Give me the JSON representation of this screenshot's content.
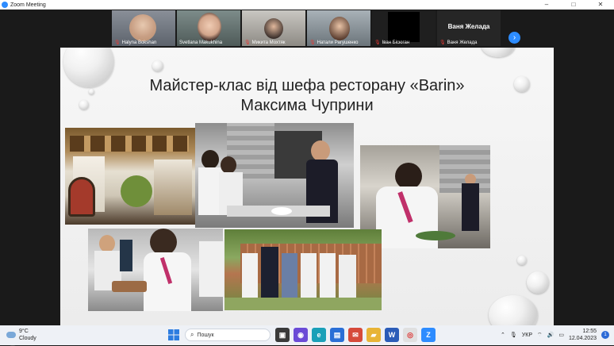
{
  "window": {
    "title": "Zoom Meeting",
    "controls": [
      "–",
      "□",
      "✕"
    ]
  },
  "participants": [
    {
      "name": "Halyna Bokshan",
      "muted": true
    },
    {
      "name": "Svetlana Makukhina",
      "muted": false
    },
    {
      "name": "Микита Мохтяк",
      "muted": true
    },
    {
      "name": "Натали Рагушенко",
      "muted": true
    },
    {
      "name": "Іван Бісюган",
      "muted": true
    },
    {
      "name": "Ваня Желада",
      "muted": true,
      "display_name": "Ваня Желада"
    }
  ],
  "next_page": "›",
  "slide": {
    "title_line1": "Майстер-клас від шефа ресторану «Barin»",
    "title_line2": "Максима Чуприни"
  },
  "annotate_icon": "pencil-icon",
  "taskbar": {
    "weather_temp": "9°C",
    "weather_desc": "Cloudy",
    "search_placeholder": "Пошук",
    "language": "УКР",
    "time": "12:55",
    "date": "12.04.2023",
    "notifications": "1"
  },
  "colors": {
    "zoom_blue": "#2d8cff",
    "muted_red": "#e53935"
  }
}
